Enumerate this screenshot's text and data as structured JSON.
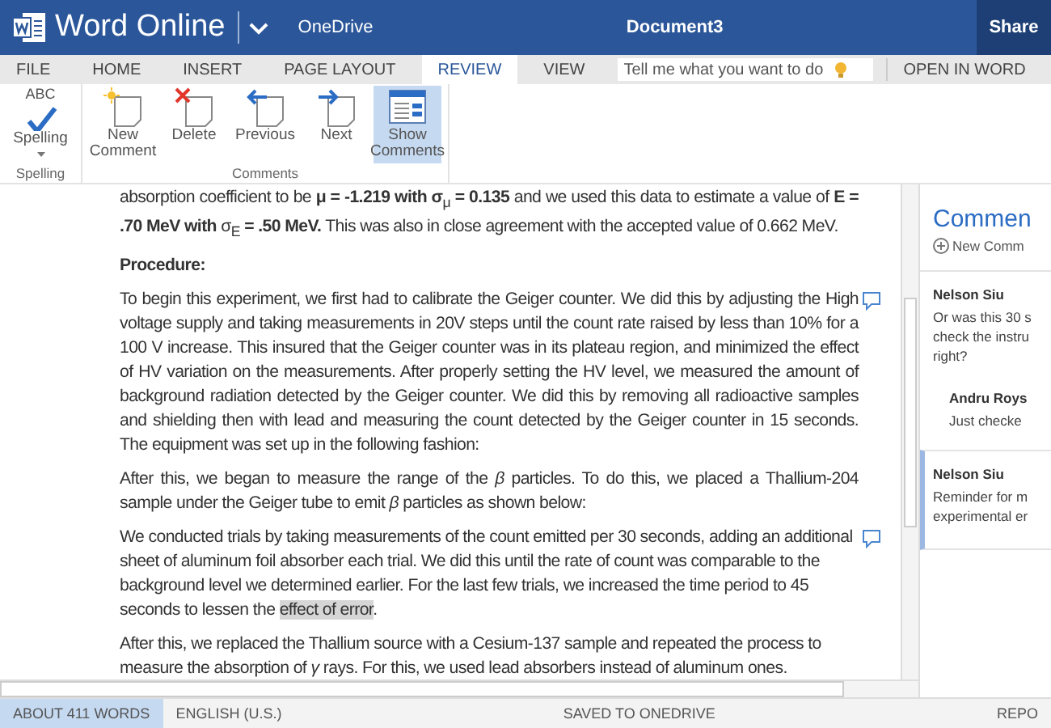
{
  "app": {
    "name": "Word Online",
    "location": "OneDrive",
    "document_title": "Document3",
    "share_button": "Share"
  },
  "tabs": [
    {
      "label": "FILE",
      "selected": false
    },
    {
      "label": "HOME",
      "selected": false
    },
    {
      "label": "INSERT",
      "selected": false
    },
    {
      "label": "PAGE LAYOUT",
      "selected": false
    },
    {
      "label": "REVIEW",
      "selected": true
    },
    {
      "label": "VIEW",
      "selected": false
    }
  ],
  "search": {
    "placeholder": "Tell me what you want to do"
  },
  "open_in_word": "OPEN IN WORD",
  "ribbon_groups": [
    {
      "label": "Spelling",
      "buttons": [
        {
          "kind": "spelling",
          "icon_text": "ABC",
          "label": "Spelling",
          "on": false
        }
      ]
    },
    {
      "label": "Comments",
      "buttons": [
        {
          "kind": "new-comment",
          "label": "New Comment",
          "on": false
        },
        {
          "kind": "delete",
          "label": "Delete",
          "on": false
        },
        {
          "kind": "previous",
          "label": "Previous",
          "on": false
        },
        {
          "kind": "next",
          "label": "Next",
          "on": false
        },
        {
          "kind": "show-comments",
          "label": "Show Comments",
          "on": true
        }
      ]
    }
  ],
  "document": {
    "blocks": [
      {
        "kind": "paragraph",
        "justify": true,
        "comment": false,
        "runs": [
          {
            "text": "absorption coefficient to be **μ = -1.219 with σ**$_{μ}$ **= 0.135** and we used this data to estimate a value of **E = .70 MeV with** σ$_{E}$ **= .50 MeV.** This was also in close agreement with the accepted value of 0.662 MeV.",
            "highlighted": false
          }
        ]
      },
      {
        "kind": "heading",
        "text": "Procedure:"
      },
      {
        "kind": "paragraph",
        "justify": true,
        "comment": true,
        "runs": [
          {
            "text": "To begin this experiment, we first had to calibrate the Geiger counter. We did this by adjusting the High voltage supply and taking measurements in 20V steps until the count rate raised by less than 10% for a 100 V increase. This insured that the Geiger counter was in its plateau region, and minimized the effect of HV variation on the measurements. After properly setting the HV level, we measured the amount of background radiation detected by the Geiger counter. We did this by removing all radioactive samples and shielding then with lead and measuring the count detected by the Geiger counter in 15 seconds. The equipment was set up in the following fashion:",
            "highlighted": false
          }
        ]
      },
      {
        "kind": "paragraph",
        "justify": true,
        "comment": false,
        "runs": [
          {
            "text": "After this, we began to measure the range of the *β* particles. To do this, we placed a Thallium-204 sample under the Geiger tube to emit *β* particles as shown below:",
            "highlighted": false
          }
        ]
      },
      {
        "kind": "paragraph",
        "justify": false,
        "comment": true,
        "runs": [
          {
            "text": "We conducted trials by taking measurements of the count emitted per 30 seconds, adding an additional sheet of aluminum foil absorber each trial. We did this until the rate of count was comparable to the background level we determined earlier. For the last few trials, we increased the time period to 45 seconds to lessen the ",
            "highlighted": false
          },
          {
            "text": "effect of error",
            "highlighted": true
          },
          {
            "text": ".",
            "highlighted": false
          }
        ]
      },
      {
        "kind": "paragraph",
        "justify": false,
        "comment": false,
        "runs": [
          {
            "text": "After this, we replaced the Thallium source with a Cesium-137 sample and repeated the process to measure the absorption of *γ* rays. For this, we used lead absorbers instead of aluminum ones.",
            "highlighted": false
          }
        ]
      }
    ]
  },
  "comments_pane": {
    "title": "Commen",
    "new_comment": "New Comm",
    "threads": [
      {
        "selected": false,
        "author": "Nelson Siu",
        "lines": [
          "Or was this 30 s",
          "check the instru",
          "right?"
        ],
        "replies": [
          {
            "author": "Andru Roys",
            "lines": [
              "Just checke"
            ]
          }
        ]
      },
      {
        "selected": true,
        "author": "Nelson Siu",
        "lines": [
          "Reminder for m",
          "experimental er"
        ]
      }
    ]
  },
  "status_bar": [
    {
      "label": "ABOUT 411 WORDS",
      "selected": true
    },
    {
      "label": "ENGLISH (U.S.)",
      "selected": false
    },
    {
      "label": "SAVED TO ONEDRIVE",
      "selected": false
    },
    {
      "label": "REPO",
      "selected": false
    }
  ]
}
